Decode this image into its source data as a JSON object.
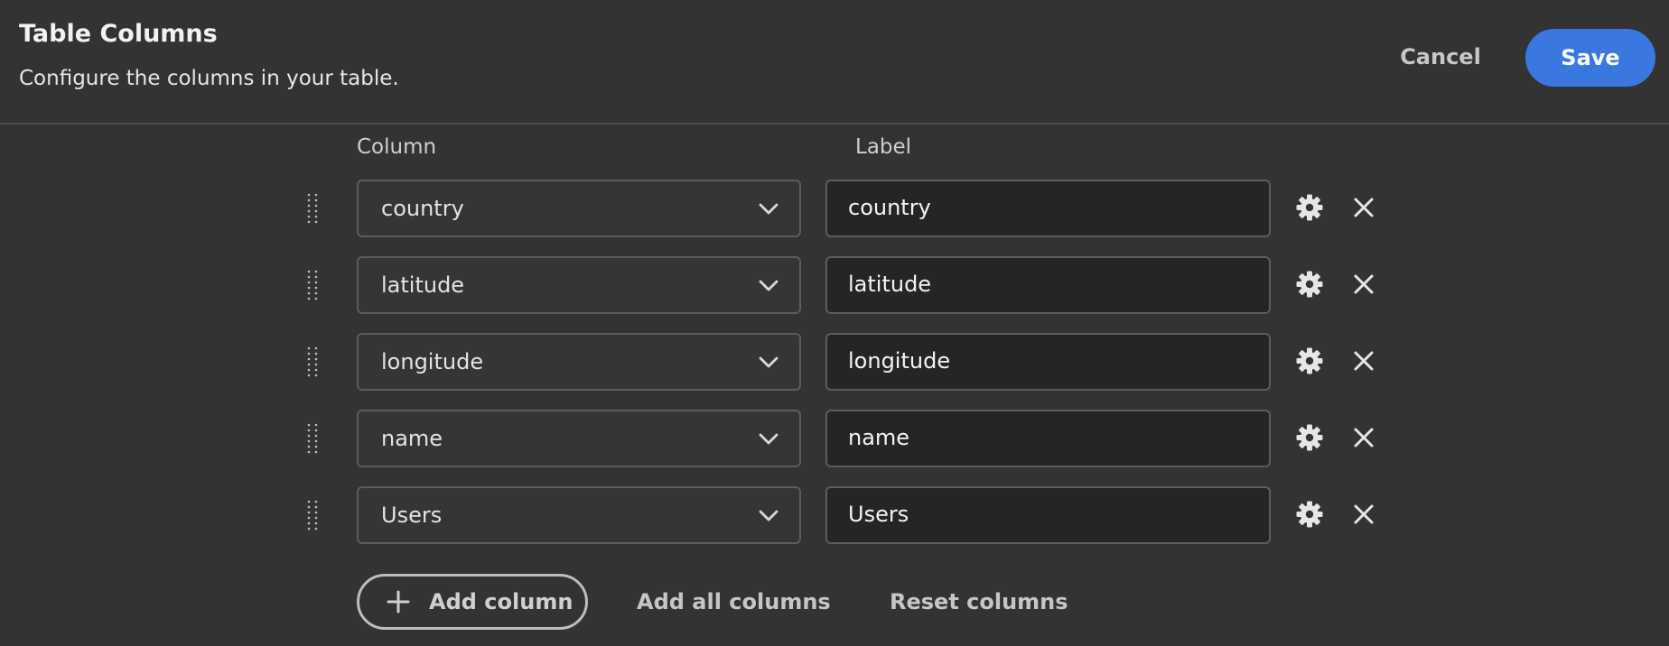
{
  "header": {
    "title": "Table Columns",
    "subtitle": "Configure the columns in your table.",
    "cancel_label": "Cancel",
    "save_label": "Save"
  },
  "columns_header": {
    "column": "Column",
    "label": "Label"
  },
  "rows": [
    {
      "column": "country",
      "label": "country"
    },
    {
      "column": "latitude",
      "label": "latitude"
    },
    {
      "column": "longitude",
      "label": "longitude"
    },
    {
      "column": "name",
      "label": "name"
    },
    {
      "column": "Users",
      "label": "Users"
    }
  ],
  "actions": {
    "add_column": "Add column",
    "add_all_columns": "Add all columns",
    "reset_columns": "Reset columns"
  },
  "colors": {
    "background": "#333333",
    "accent": "#3a78e0",
    "input_background": "#252525",
    "select_background": "#353535"
  },
  "icons": {
    "drag_handle": "drag-handle-icon",
    "chevron": "chevron-down-icon",
    "settings": "gear-icon",
    "remove": "close-icon",
    "add": "plus-icon"
  }
}
